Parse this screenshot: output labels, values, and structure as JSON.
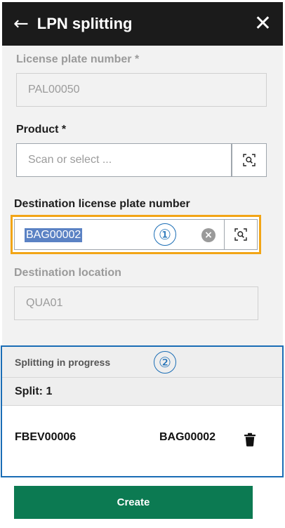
{
  "header": {
    "title": "LPN splitting",
    "back_icon": "arrow-left-icon",
    "close_icon": "close-icon"
  },
  "form": {
    "license_plate": {
      "label": "License plate number *",
      "value": "PAL00050"
    },
    "product": {
      "label": "Product *",
      "placeholder": "Scan or select ...",
      "scan_icon": "scan-search-icon"
    },
    "destination_lpn": {
      "label": "Destination license plate number",
      "value": "BAG00002",
      "clear_icon": "clear-circle-icon",
      "scan_icon": "scan-search-icon"
    },
    "destination_location": {
      "label": "Destination location",
      "value": "QUA01"
    }
  },
  "markers": {
    "one": "①",
    "two": "②"
  },
  "progress": {
    "heading": "Splitting in progress",
    "split_label": "Split: 1",
    "items": [
      {
        "product": "FBEV00006",
        "lpn": "BAG00002",
        "action_icon": "trash-icon"
      }
    ]
  },
  "actions": {
    "create_label": "Create"
  },
  "colors": {
    "header_bg": "#1b1b1b",
    "highlight": "#f2a516",
    "annotation": "#1a6db5",
    "primary": "#0c7a52"
  }
}
